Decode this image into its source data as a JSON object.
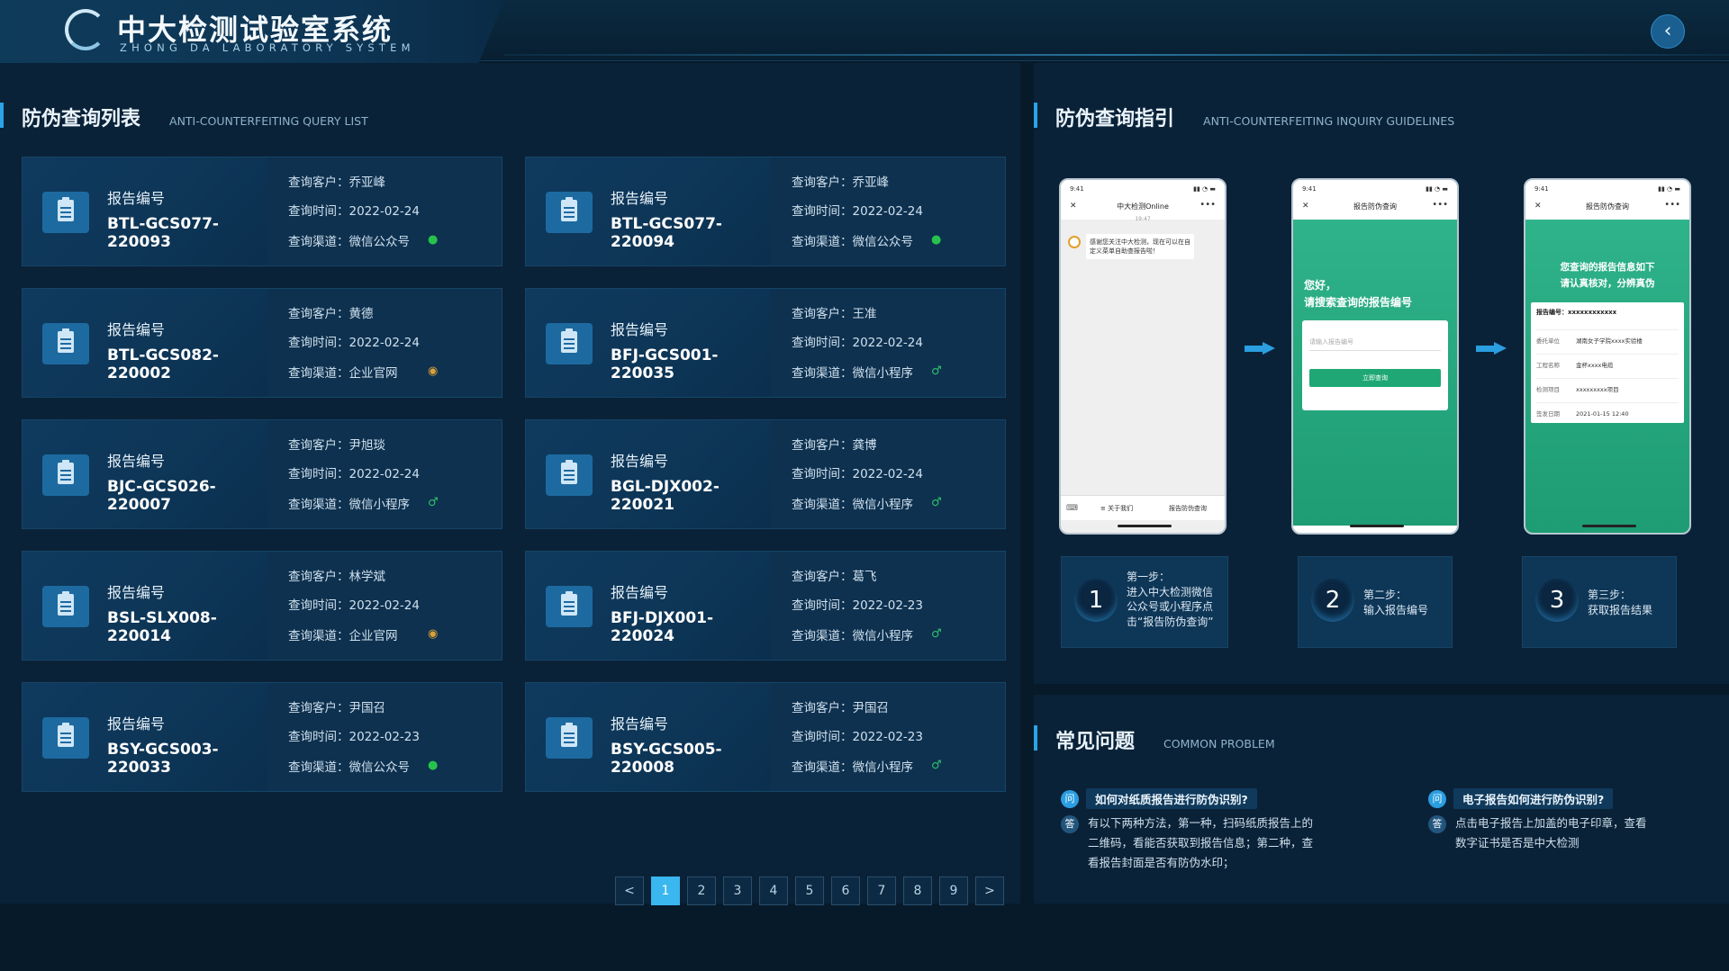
{
  "header": {
    "title": "中大检测试验室系统",
    "subtitle": "ZHONG DA LABORATORY SYSTEM",
    "back_icon": "chevron-left-icon"
  },
  "query_list": {
    "title": "防伪查询列表",
    "title_en": "ANTI-COUNTERFEITING QUERY LIST",
    "report_label": "报告编号",
    "customer_label": "查询客户：",
    "time_label": "查询时间：",
    "channel_label": "查询渠道：",
    "cards": [
      {
        "code": "BTL-GCS077-220093",
        "customer": "乔亚峰",
        "time": "2022-02-24",
        "channel": "微信公众号",
        "channel_icon": "wechat-icon"
      },
      {
        "code": "BTL-GCS077-220094",
        "customer": "乔亚峰",
        "time": "2022-02-24",
        "channel": "微信公众号",
        "channel_icon": "wechat-icon"
      },
      {
        "code": "BTL-GCS082-220002",
        "customer": "黄德",
        "time": "2022-02-24",
        "channel": "企业官网",
        "channel_icon": "website-icon"
      },
      {
        "code": "BFJ-GCS001-220035",
        "customer": "王准",
        "time": "2022-02-24",
        "channel": "微信小程序",
        "channel_icon": "mini-program-icon"
      },
      {
        "code": "BJC-GCS026-220007",
        "customer": "尹旭琰",
        "time": "2022-02-24",
        "channel": "微信小程序",
        "channel_icon": "mini-program-icon"
      },
      {
        "code": "BGL-DJX002-220021",
        "customer": "龚博",
        "time": "2022-02-24",
        "channel": "微信小程序",
        "channel_icon": "mini-program-icon"
      },
      {
        "code": "BSL-SLX008-220014",
        "customer": "林学斌",
        "time": "2022-02-24",
        "channel": "企业官网",
        "channel_icon": "website-icon"
      },
      {
        "code": "BFJ-DJX001-220024",
        "customer": "葛飞",
        "time": "2022-02-23",
        "channel": "微信小程序",
        "channel_icon": "mini-program-icon"
      },
      {
        "code": "BSY-GCS003-220033",
        "customer": "尹国召",
        "time": "2022-02-23",
        "channel": "微信公众号",
        "channel_icon": "wechat-icon"
      },
      {
        "code": "BSY-GCS005-220008",
        "customer": "尹国召",
        "time": "2022-02-23",
        "channel": "微信小程序",
        "channel_icon": "mini-program-icon"
      }
    ],
    "pager": {
      "prev": "<",
      "next": ">",
      "pages": [
        "1",
        "2",
        "3",
        "4",
        "5",
        "6",
        "7",
        "8",
        "9"
      ],
      "current": "1"
    }
  },
  "guide": {
    "title": "防伪查询指引",
    "title_en": "ANTI-COUNTERFEITING INQUIRY GUIDELINES",
    "phone1": {
      "time": "9:41",
      "nav_title": "中大检测Online",
      "nav_time": "19:47",
      "message": "感谢您关注中大检测，现在可以在自定义菜单自助查报告啦！",
      "menu_1": "≡ 关于我们",
      "menu_2": "报告防伪查询"
    },
    "phone2": {
      "time": "9:41",
      "nav_title": "报告防伪查询",
      "hero_line1": "您好，",
      "hero_line2": "请搜索查询的报告编号",
      "input_placeholder": "请输入报告编号",
      "button": "立即查询"
    },
    "phone3": {
      "time": "9:41",
      "nav_title": "报告防伪查询",
      "hero_line1": "您查询的报告信息如下",
      "hero_line2": "请认真核对，分辨真伪",
      "report_no_label": "报告编号：",
      "report_no": "xxxxxxxxxxxx",
      "rows": [
        {
          "k": "委托单位",
          "v": "湖南女子学院xxxx实验楼"
        },
        {
          "k": "工程名称",
          "v": "金杯xxxx电缆"
        },
        {
          "k": "检测项目",
          "v": "xxxxxxxxx项目"
        },
        {
          "k": "签发日期",
          "v": "2021-01-15 12:40"
        }
      ]
    },
    "steps": [
      {
        "num": "1",
        "lines": [
          "第一步：",
          "进入中大检测微信",
          "公众号或小程序点",
          "击“报告防伪查询”"
        ]
      },
      {
        "num": "2",
        "lines": [
          "第二步：",
          "输入报告编号"
        ]
      },
      {
        "num": "3",
        "lines": [
          "第三步：",
          "获取报告结果"
        ]
      }
    ]
  },
  "faq": {
    "title": "常见问题",
    "title_en": "COMMON PROBLEM",
    "q_badge": "问",
    "a_badge": "答",
    "items": [
      {
        "q": "如何对纸质报告进行防伪识别?",
        "a": [
          "有以下两种方法，第一种，扫码纸质报告上的",
          "二维码，看能否获取到报告信息；第二种，查",
          "看报告封面是否有防伪水印；"
        ]
      },
      {
        "q": "电子报告如何进行防伪识别?",
        "a": [
          "点击电子报告上加盖的电子印章，查看",
          "数字证书是否是中大检测"
        ]
      }
    ]
  },
  "colors": {
    "accent": "#2aa4e6",
    "wechat": "#27c24c",
    "page_active": "#39b7ee"
  }
}
